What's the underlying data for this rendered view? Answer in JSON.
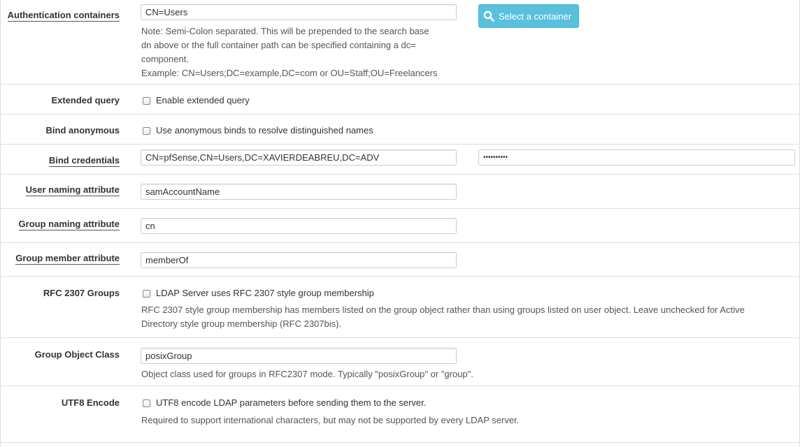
{
  "auth_containers": {
    "label": "Authentication containers",
    "value": "CN=Users",
    "help": [
      "Note: Semi-Colon separated. This will be prepended to the search base",
      "dn above or the full container path can be specified containing a dc=",
      "component.",
      "Example: CN=Users;DC=example,DC=com or OU=Staff;OU=Freelancers"
    ],
    "button_label": "Select a container"
  },
  "extended_query": {
    "label": "Extended query",
    "checkbox_label": "Enable extended query",
    "checked": false
  },
  "bind_anonymous": {
    "label": "Bind anonymous",
    "checkbox_label": "Use anonymous binds to resolve distinguished names",
    "checked": false
  },
  "bind_credentials": {
    "label": "Bind credentials",
    "user_value": "CN=pfSense,CN=Users,DC=XAVIERDEABREU,DC=ADV",
    "password_mask": "••••••••••"
  },
  "user_naming": {
    "label": "User naming attribute",
    "value": "samAccountName"
  },
  "group_naming": {
    "label": "Group naming attribute",
    "value": "cn"
  },
  "group_member": {
    "label": "Group member attribute",
    "value": "memberOf"
  },
  "rfc2307": {
    "label": "RFC 2307 Groups",
    "checkbox_label": "LDAP Server uses RFC 2307 style group membership",
    "checked": false,
    "help": [
      "RFC 2307 style group membership has members listed on the group object rather than using groups listed on user object. Leave unchecked for Active",
      "Directory style group membership (RFC 2307bis)."
    ]
  },
  "group_object_class": {
    "label": "Group Object Class",
    "value": "posixGroup",
    "help": "Object class used for groups in RFC2307 mode. Typically \"posixGroup\" or \"group\"."
  },
  "utf8": {
    "label": "UTF8 Encode",
    "checkbox_label": "UTF8 encode LDAP parameters before sending them to the server.",
    "checked": false,
    "help": "Required to support international characters, but may not be supported by every LDAP server."
  }
}
